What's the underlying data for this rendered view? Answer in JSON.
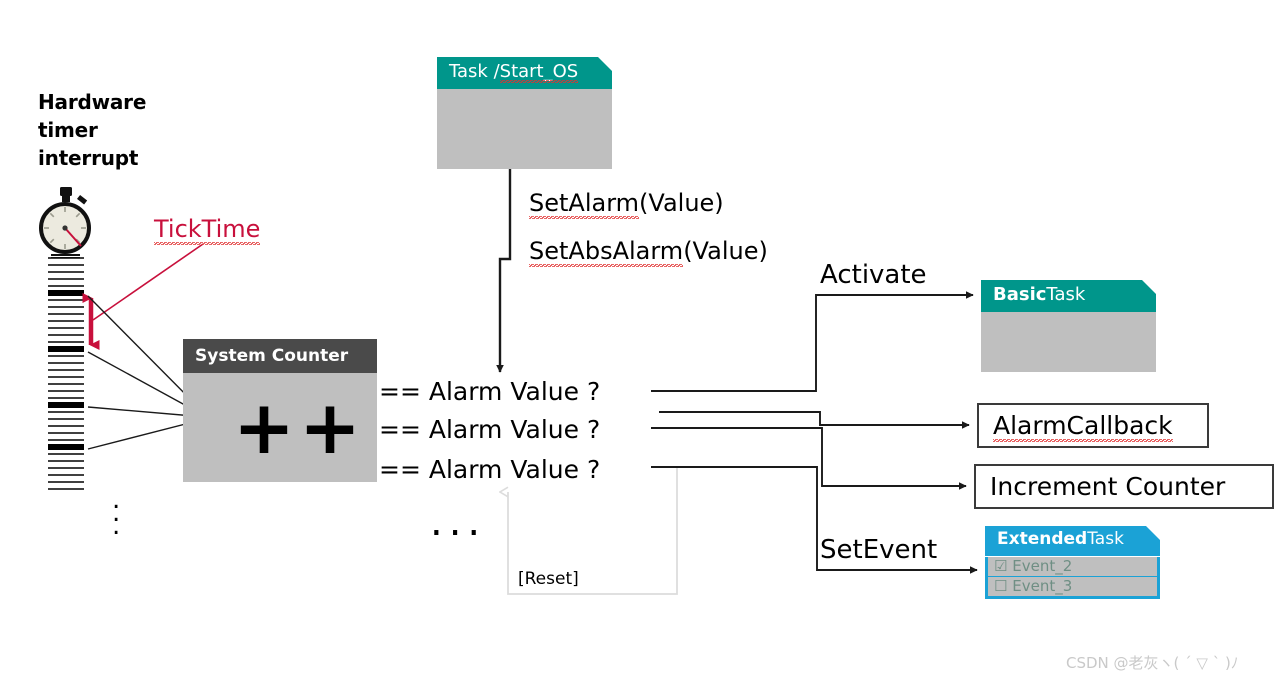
{
  "diagram": {
    "title_left": "Hardware\ntimer\ninterrupt",
    "hardware_label_lines": [
      "Hardware",
      "timer",
      "interrupt"
    ],
    "ticktime_label": "TickTime",
    "stopwatch_icon": "stopwatch-icon",
    "tick_ellipsis": "⋮"
  },
  "task_start_os": {
    "header_bold": "",
    "header_text": "Task /Start_OS",
    "header_plain": "Task /",
    "header_spell": "Start_OS"
  },
  "calls": {
    "set_alarm_spell": "SetAlarm",
    "set_alarm_args": "(Value)",
    "set_abs_alarm_spell": "SetAbsAlarm",
    "set_abs_alarm_args": "(Value)"
  },
  "system_counter": {
    "header": "System Counter",
    "increment_symbol": "++"
  },
  "alarms": {
    "rows": [
      "==  Alarm Value ?",
      "==  Alarm Value ?",
      "==  Alarm Value ?"
    ],
    "ellipsis": "...",
    "reset_label": "[Reset]"
  },
  "actions": {
    "activate": "Activate",
    "set_event": "SetEvent"
  },
  "targets": {
    "basic_task": {
      "bold": "Basic",
      "plain": "Task"
    },
    "alarm_callback": "AlarmCallback",
    "increment_counter": "Increment Counter",
    "extended_task": {
      "bold": "Extended",
      "plain": "Task"
    },
    "events": [
      {
        "checkbox": "☑",
        "label": "Event_2"
      },
      {
        "checkbox": "☐",
        "label": "Event_3"
      }
    ]
  },
  "colors": {
    "teal": "#00968b",
    "light_blue": "#1ba2d6",
    "gray_body": "#bfbfbf",
    "dark_header": "#4a4a4a",
    "crimson": "#c8103c",
    "line": "#1a1a1a",
    "reset_line": "#d8d8d8"
  },
  "watermark": {
    "text": "CSDN @老灰ヽ( ´ ▽ ` )ﾉ"
  }
}
